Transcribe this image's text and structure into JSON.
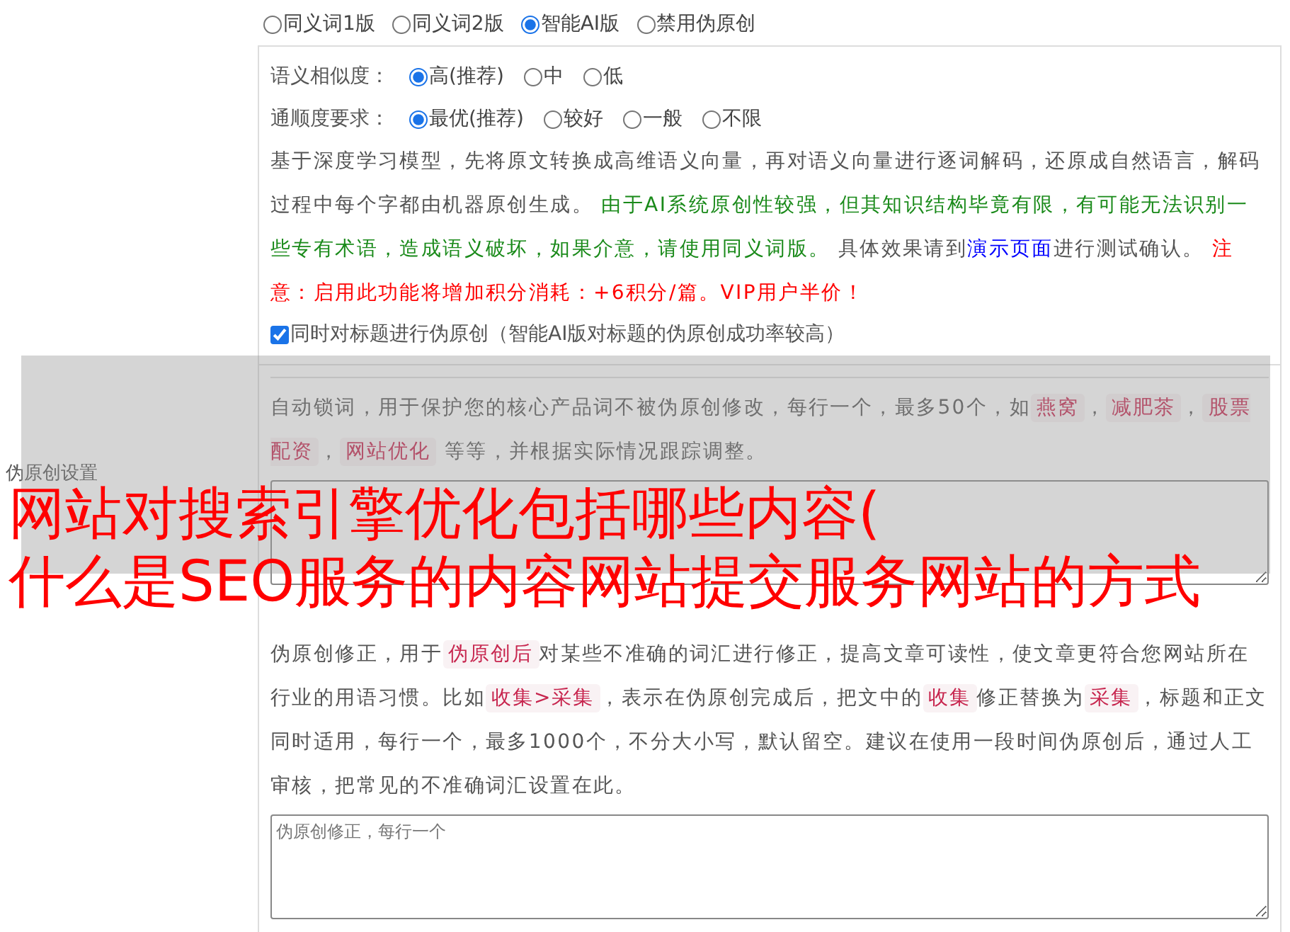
{
  "mode_options": [
    {
      "label": "同义词1版",
      "selected": false
    },
    {
      "label": "同义词2版",
      "selected": false
    },
    {
      "label": "智能AI版",
      "selected": true
    },
    {
      "label": "禁用伪原创",
      "selected": false
    }
  ],
  "ai_settings": {
    "groups": [
      {
        "label": "语义相似度：",
        "options": [
          {
            "label": "高(推荐)",
            "selected": true
          },
          {
            "label": "中",
            "selected": false
          },
          {
            "label": "低",
            "selected": false
          }
        ]
      },
      {
        "label": "通顺度要求：",
        "options": [
          {
            "label": "最优(推荐)",
            "selected": true
          },
          {
            "label": "较好",
            "selected": false
          },
          {
            "label": "一般",
            "selected": false
          },
          {
            "label": "不限",
            "selected": false
          }
        ]
      }
    ],
    "description": [
      {
        "kind": "text",
        "text": "基于深度学习模型，先将原文转换成高维语义向量，再对语义向量进行逐词解码，还原成自然语言，解码过程中每个字都由机器原创生成。 "
      },
      {
        "kind": "note",
        "text": "由于AI系统原创性较强，但其知识结构毕竟有限，有可能无法识别一些专有术语，造成语义破坏，如果介意，请使用同义词版。"
      },
      {
        "kind": "text",
        "text": " 具体效果请到"
      },
      {
        "kind": "link",
        "text": "演示页面"
      },
      {
        "kind": "text",
        "text": "进行测试确认。 "
      },
      {
        "kind": "warning",
        "text": "注意：启用此功能将增加积分消耗：+6积分/篇。VIP用户半价！"
      }
    ],
    "title_option": {
      "label": "同时对标题进行伪原创（智能AI版对标题的伪原创成功率较高）",
      "checked": true
    }
  },
  "section_label": "伪原创设置",
  "auto_lock": {
    "description": [
      {
        "kind": "text",
        "text": "自动锁词，用于保护您的核心产品词不被伪原创修改，每行一个，最多50个，如"
      },
      {
        "kind": "tag",
        "text": "燕窝"
      },
      {
        "kind": "text",
        "text": "，"
      },
      {
        "kind": "tag",
        "text": "减肥茶"
      },
      {
        "kind": "text",
        "text": "，"
      },
      {
        "kind": "tag",
        "text": "股票配资"
      },
      {
        "kind": "text",
        "text": "，"
      },
      {
        "kind": "tag",
        "text": "网站优化"
      },
      {
        "kind": "text",
        "text": " 等等，并根据实际情况跟踪调整。"
      }
    ]
  },
  "correction": {
    "description": [
      {
        "kind": "text",
        "text": "伪原创修正，用于"
      },
      {
        "kind": "tag",
        "text": "伪原创后"
      },
      {
        "kind": "text",
        "text": "对某些不准确的词汇进行修正，提高文章可读性，使文章更符合您网站所在行业的用语习惯。比如"
      },
      {
        "kind": "tag",
        "text": "收集>采集"
      },
      {
        "kind": "text",
        "text": "，表示在伪原创完成后，把文中的"
      },
      {
        "kind": "tag",
        "text": "收集"
      },
      {
        "kind": "text",
        "text": "修正替换为"
      },
      {
        "kind": "tag",
        "text": "采集"
      },
      {
        "kind": "text",
        "text": "，标题和正文同时适用，每行一个，最多1000个，不分大小写，默认留空。建议在使用一段时间伪原创后，通过人工审核，把常见的不准确词汇设置在此。"
      }
    ],
    "placeholder": "伪原创修正，每行一个"
  },
  "overlay": {
    "lines": [
      "网站对搜索引擎优化包括哪些内容(",
      "什么是SEO服务的内容网站提交服务网站的方式"
    ]
  }
}
